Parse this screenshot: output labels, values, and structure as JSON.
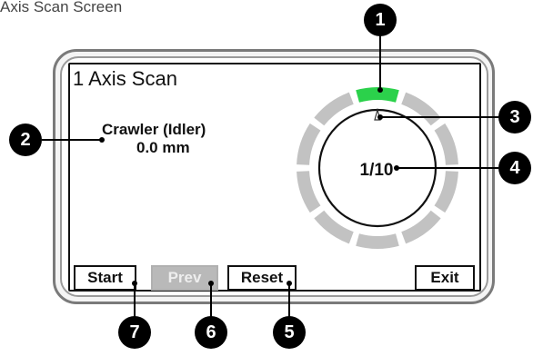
{
  "document": {
    "title": "Axis Scan Screen"
  },
  "device": {
    "screen_title": "1 Axis Scan",
    "status": {
      "label": "Crawler (Idler)",
      "value": "0.0 mm"
    },
    "progress_ring": {
      "segments_total": 10,
      "active_segment": 1,
      "text": "1/10",
      "active_color": "#2bd14b",
      "inactive_color": "#c2c2c2"
    },
    "buttons": {
      "start": "Start",
      "prev": "Prev",
      "reset": "Reset",
      "exit": "Exit"
    }
  },
  "callouts": [
    "1",
    "2",
    "3",
    "4",
    "5",
    "6",
    "7"
  ],
  "colors": {
    "bezel": "#7a7a7a",
    "screen_border": "#111111",
    "disabled_button": "#b9b9b9"
  }
}
